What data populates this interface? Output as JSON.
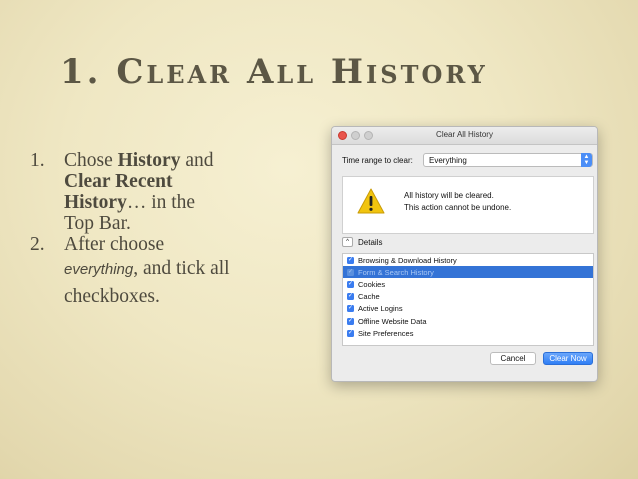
{
  "slide": {
    "title": "1. Clear All History",
    "bullets": [
      {
        "num": "1.",
        "lines": [
          [
            "Chose ",
            "History",
            " and"
          ],
          [
            "Clear Recent"
          ],
          [
            "History",
            "… in the"
          ],
          [
            "Top Bar."
          ]
        ]
      },
      {
        "num": "2.",
        "lines": [
          [
            "After choose"
          ],
          [
            "everything",
            ", and tick all"
          ],
          [
            "checkboxes."
          ]
        ]
      }
    ]
  },
  "dialog": {
    "title": "Clear All History",
    "time_range_label": "Time range to clear:",
    "time_range_value": "Everything",
    "warning_line1": "All history will be cleared.",
    "warning_line2": "This action cannot be undone.",
    "details_label": "Details",
    "items": [
      {
        "label": "Browsing & Download History",
        "checked": true,
        "selected": false
      },
      {
        "label": "Form & Search History",
        "checked": true,
        "selected": true
      },
      {
        "label": "Cookies",
        "checked": true,
        "selected": false
      },
      {
        "label": "Cache",
        "checked": true,
        "selected": false
      },
      {
        "label": "Active Logins",
        "checked": true,
        "selected": false
      },
      {
        "label": "Offline Website Data",
        "checked": true,
        "selected": false
      },
      {
        "label": "Site Preferences",
        "checked": true,
        "selected": false
      }
    ],
    "cancel_label": "Cancel",
    "clear_now_label": "Clear Now",
    "colors": {
      "accent": "#3a7cf0",
      "close": "#e9544b",
      "warning": "#f1c40f"
    }
  }
}
